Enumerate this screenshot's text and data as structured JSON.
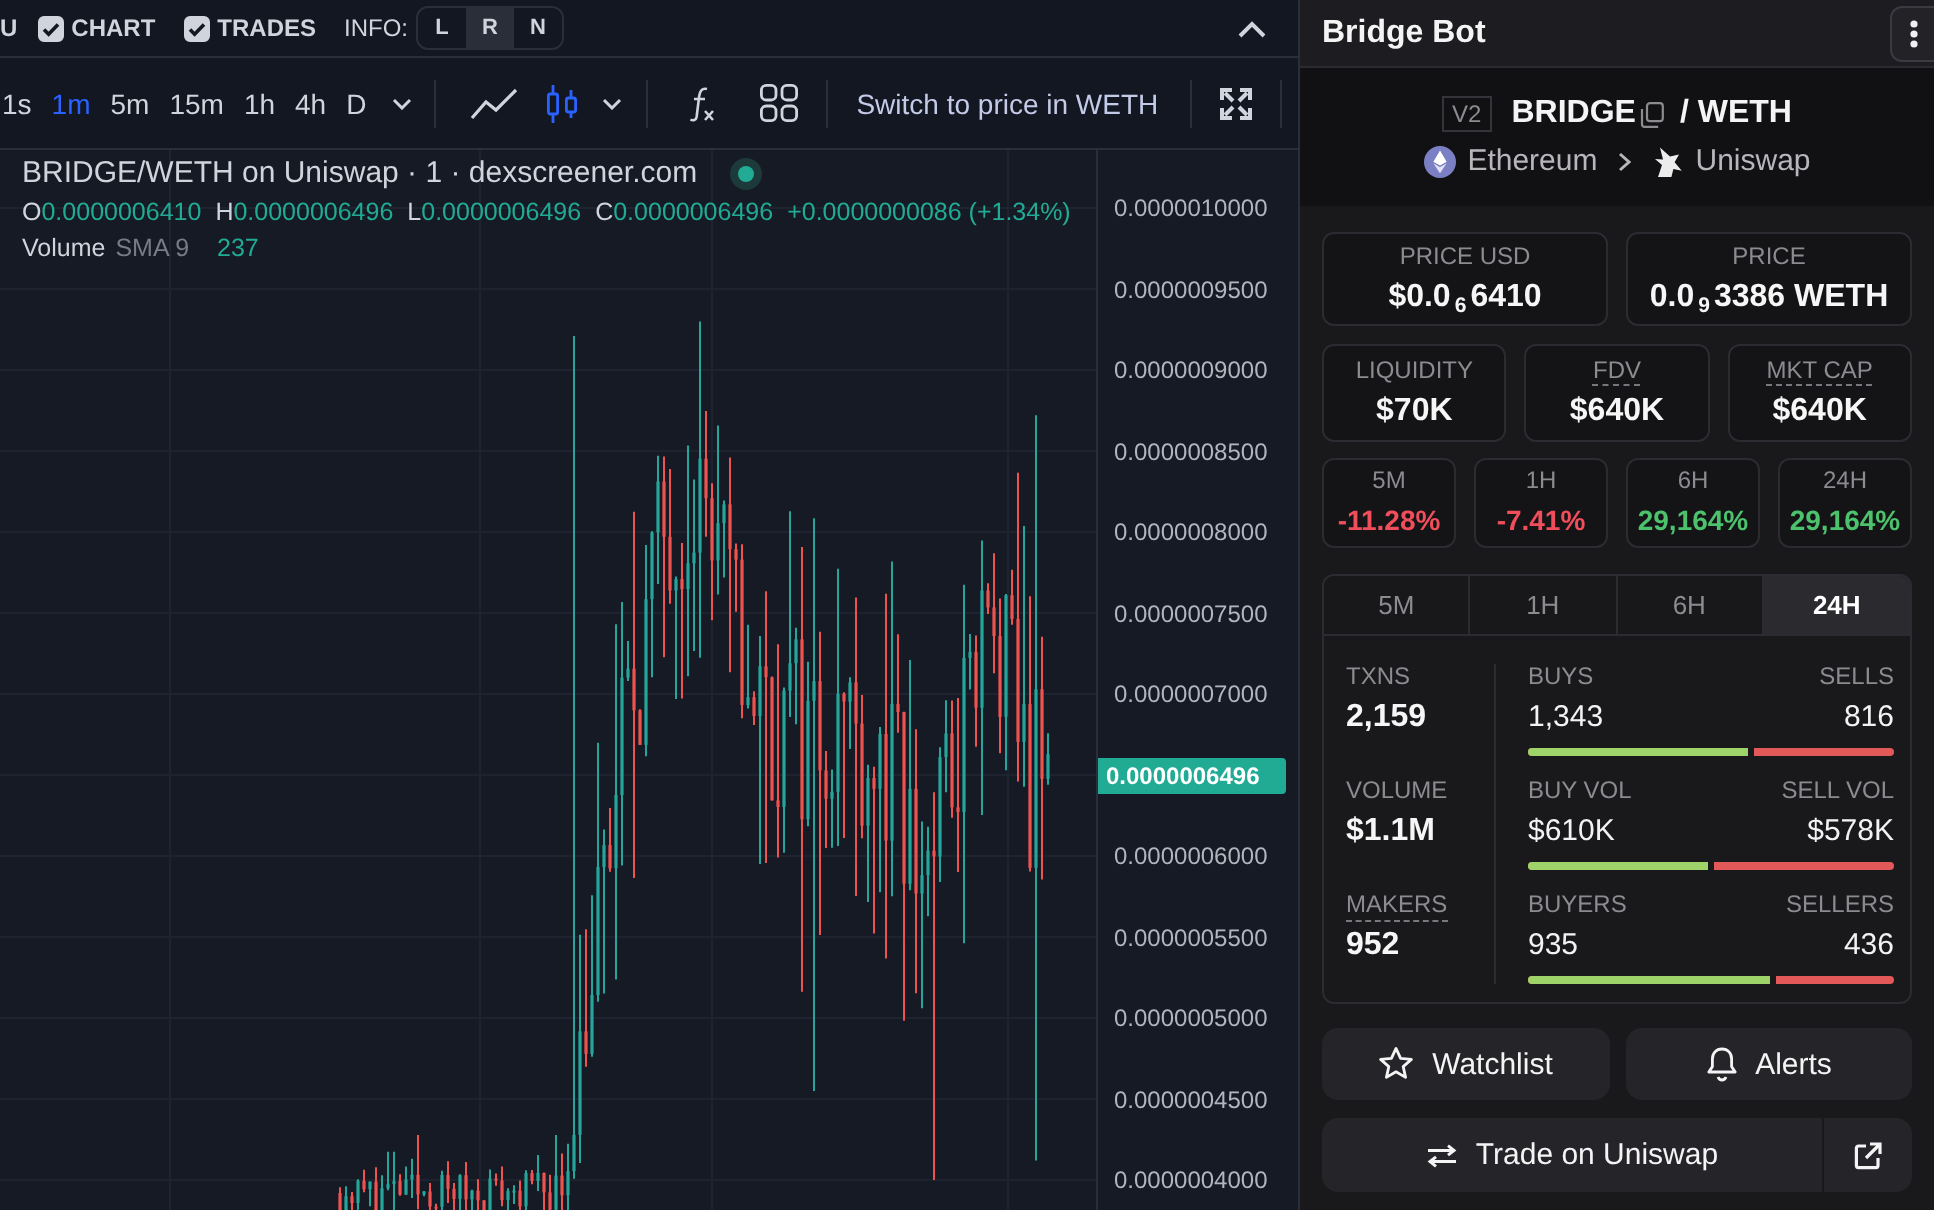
{
  "top_bar": {
    "cut_label": "U",
    "toggles": [
      {
        "label": "CHART",
        "checked": true
      },
      {
        "label": "TRADES",
        "checked": true
      }
    ],
    "info": {
      "label": "INFO:",
      "options": [
        {
          "label": "L",
          "selected": false
        },
        {
          "label": "R",
          "selected": true
        },
        {
          "label": "N",
          "selected": false
        }
      ]
    }
  },
  "chart_toolbar": {
    "intervals": [
      {
        "label": "1s",
        "selected": false
      },
      {
        "label": "1m",
        "selected": true
      },
      {
        "label": "5m",
        "selected": false
      },
      {
        "label": "15m",
        "selected": false
      },
      {
        "label": "1h",
        "selected": false
      },
      {
        "label": "4h",
        "selected": false
      },
      {
        "label": "D",
        "selected": false
      }
    ],
    "chart_types": [
      {
        "kind": "line",
        "selected": false
      },
      {
        "kind": "candles",
        "selected": true
      }
    ],
    "price_switch": "Switch to price in WETH"
  },
  "chart": {
    "title": "BRIDGE/WETH on Uniswap · 1 · dexscreener.com",
    "ohlc": [
      {
        "key": "O",
        "value": "0.0000006410"
      },
      {
        "key": "H",
        "value": "0.0000006496"
      },
      {
        "key": "L",
        "value": "0.0000006496"
      },
      {
        "key": "C",
        "value": "0.0000006496"
      }
    ],
    "change": "+0.0000000086 (+1.34%)",
    "volume": {
      "label": "Volume",
      "indicator": "SMA 9",
      "value": "237"
    },
    "price_axis": {
      "upper": [
        "0.0000010000",
        "0.0000009500",
        "0.0000009000",
        "0.0000008500",
        "0.0000008000",
        "0.0000007500",
        "0.0000007000"
      ],
      "last_price": "0.0000006496",
      "lower": [
        "0.0000006000",
        "0.0000005500",
        "0.0000005000",
        "0.0000004500",
        "0.0000004000"
      ]
    }
  },
  "panel": {
    "title": "Bridge Bot",
    "pair": {
      "version": "V2",
      "base": "BRIDGE",
      "quote": "/ WETH",
      "chain": "Ethereum",
      "dex": "Uniswap"
    },
    "prices": [
      {
        "label": "PRICE USD",
        "value": "$0.0$_{6}$6410"
      },
      {
        "label": "PRICE",
        "value": "0.0$_{9}$3386 WETH"
      }
    ],
    "metrics": [
      {
        "label": "LIQUIDITY",
        "value": "$70K",
        "underlined": false
      },
      {
        "label": "FDV",
        "value": "$640K",
        "underlined": true
      },
      {
        "label": "MKT CAP",
        "value": "$640K",
        "underlined": true
      }
    ],
    "changes": [
      {
        "label": "5M",
        "value": "-11.28%",
        "color": "#f14e5b"
      },
      {
        "label": "1H",
        "value": "-7.41%",
        "color": "#f14e5b"
      },
      {
        "label": "6H",
        "value": "29,164%",
        "color": "#4cc26c"
      },
      {
        "label": "24H",
        "value": "29,164%",
        "color": "#4cc26c"
      }
    ],
    "tabs": [
      {
        "label": "5M",
        "selected": false
      },
      {
        "label": "1H",
        "selected": false
      },
      {
        "label": "6H",
        "selected": false
      },
      {
        "label": "24H",
        "selected": true
      }
    ],
    "stats": [
      {
        "label": "TXNS",
        "value": "2,159",
        "underlined": false,
        "buy_label": "BUYS",
        "buy_value": "1,343",
        "sell_label": "SELLS",
        "sell_value": "816",
        "level": 0.62
      },
      {
        "label": "VOLUME",
        "value": "$1.1M",
        "underlined": false,
        "buy_label": "BUY VOL",
        "buy_value": "$610K",
        "sell_label": "SELL VOL",
        "sell_value": "$578K",
        "level": 0.51
      },
      {
        "label": "MAKERS",
        "value": "952",
        "underlined": true,
        "buy_label": "BUYERS",
        "buy_value": "935",
        "sell_label": "SELLERS",
        "sell_value": "436",
        "level": 0.68
      }
    ],
    "actions": [
      {
        "kind": "watchlist",
        "label": "Watchlist"
      },
      {
        "kind": "alerts",
        "label": "Alerts"
      }
    ],
    "trade": {
      "label": "Trade on Uniswap"
    }
  }
}
